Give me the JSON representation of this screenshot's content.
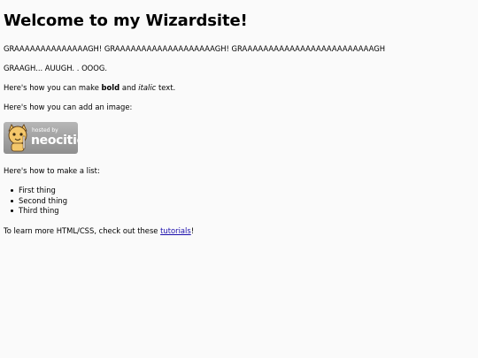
{
  "page": {
    "title": "Welcome to my Wizardsite!",
    "paragraphs": {
      "scream": "GRAAAAAAAAAAAAAAGH! GRAAAAAAAAAAAAAAAAAAAGH! GRAAAAAAAAAAAAAAAAAAAAAAAAAGH",
      "graagh": "GRAAGH... AUUGH. . OOOG.",
      "formatting_prefix": "Here's how you can make ",
      "bold_word": "bold",
      "formatting_middle": " and ",
      "italic_word": "italic",
      "formatting_suffix": " text.",
      "image_intro": "Here's how you can add an image:",
      "list_intro": "Here's how to make a list:",
      "learn_prefix": "To learn more HTML/CSS, check out these ",
      "learn_link": "tutorials",
      "learn_suffix": "!"
    },
    "badge": {
      "hosted_by": "hosted by",
      "brand": "neocities"
    },
    "list_items": [
      "First thing",
      "Second thing",
      "Third thing"
    ]
  },
  "colors": {
    "background": "#fafafa",
    "link": "#1a0dab",
    "badge_bg": "#a0a0a0"
  }
}
